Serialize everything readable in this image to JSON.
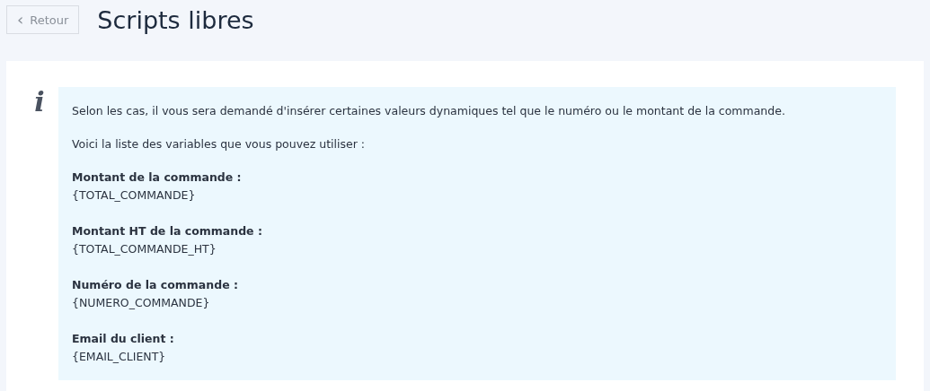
{
  "back_button": {
    "icon": "‹",
    "label": "Retour"
  },
  "title": "Scripts libres",
  "info": {
    "icon": "i",
    "paragraphs": [
      "Selon les cas, il vous sera demandé d'insérer certaines valeurs dynamiques tel que le numéro ou le montant de la commande.",
      "Voici la liste des variables que vous pouvez utiliser :"
    ],
    "variables": [
      {
        "label": "Montant de la commande :",
        "code": "{TOTAL_COMMANDE}"
      },
      {
        "label": "Montant HT de la commande :",
        "code": "{TOTAL_COMMANDE_HT}"
      },
      {
        "label": "Numéro de la commande :",
        "code": "{NUMERO_COMMANDE}"
      },
      {
        "label": "Email du client :",
        "code": "{EMAIL_CLIENT}"
      }
    ]
  }
}
